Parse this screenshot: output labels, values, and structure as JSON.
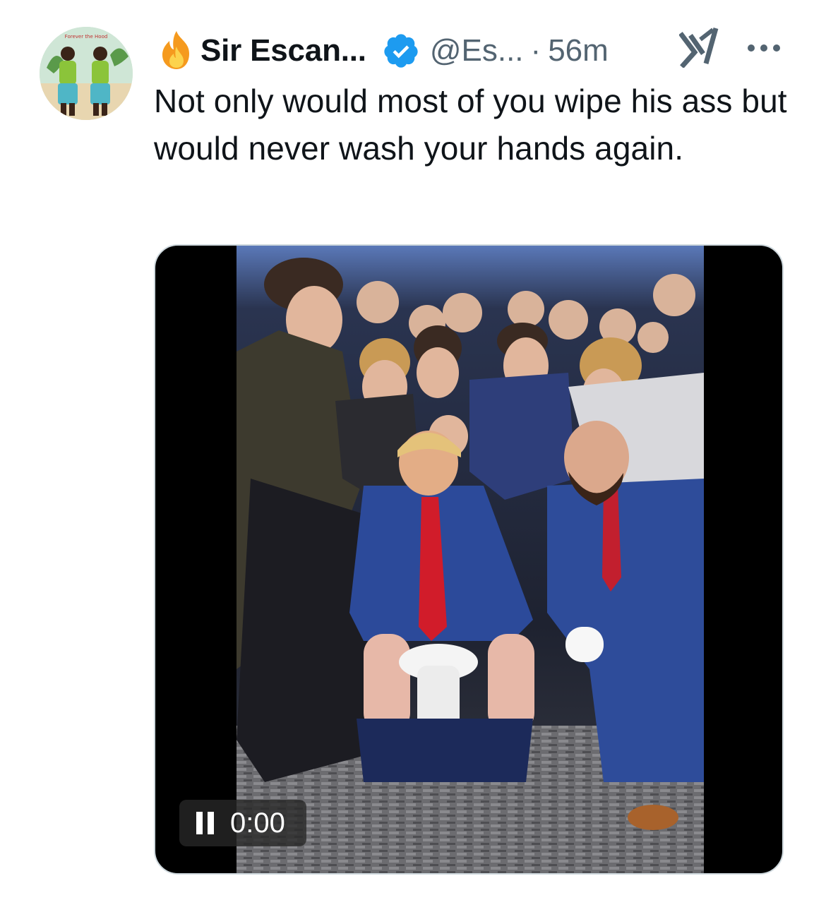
{
  "author": {
    "display_name": "Sir Escan...",
    "handle": "@Es...",
    "separator": "·",
    "timestamp": "56m",
    "verified": true,
    "name_emoji": "fire-icon",
    "avatar_caption": "Forever the Hood"
  },
  "tweet": {
    "text": "Not only would most of you wipe his ass but would never wash your hands again."
  },
  "media": {
    "type": "video",
    "state": "playing",
    "current_time": "0:00"
  },
  "icons": {
    "verified": "verified-badge-icon",
    "grok": "grok-icon",
    "more": "more-options-icon",
    "pause": "pause-icon"
  },
  "colors": {
    "text_primary": "#0f1419",
    "text_secondary": "#536471",
    "verified_blue": "#1d9bf0",
    "media_border": "#cfd9de"
  }
}
